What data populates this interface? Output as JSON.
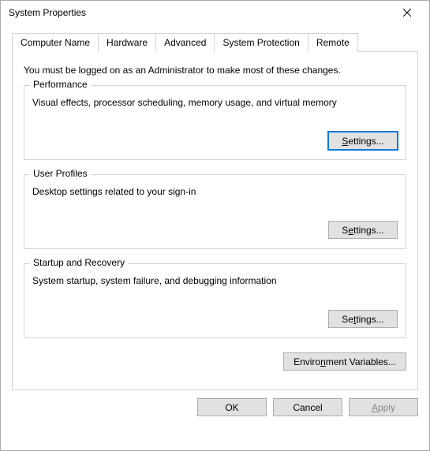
{
  "window": {
    "title": "System Properties"
  },
  "tabs": {
    "computer_name": "Computer Name",
    "hardware": "Hardware",
    "advanced": "Advanced",
    "system_protection": "System Protection",
    "remote": "Remote"
  },
  "intro": "You must be logged on as an Administrator to make most of these changes.",
  "performance": {
    "title": "Performance",
    "desc": "Visual effects, processor scheduling, memory usage, and virtual memory",
    "settings_prefix": "S",
    "settings_rest": "ettings..."
  },
  "user_profiles": {
    "title": "User Profiles",
    "desc": "Desktop settings related to your sign-in",
    "settings_prefix": "S",
    "settings_u": "e",
    "settings_rest": "ttings..."
  },
  "startup": {
    "title": "Startup and Recovery",
    "desc": "System startup, system failure, and debugging information",
    "settings_prefix": "Se",
    "settings_u": "t",
    "settings_rest": "tings..."
  },
  "env": {
    "prefix": "Enviro",
    "u": "n",
    "rest": "ment Variables..."
  },
  "footer": {
    "ok": "OK",
    "cancel": "Cancel",
    "apply_u": "A",
    "apply_rest": "pply"
  }
}
